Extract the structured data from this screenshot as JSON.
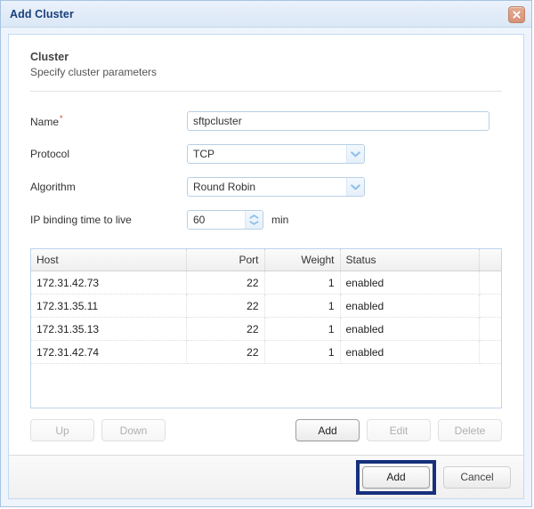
{
  "window": {
    "title": "Add Cluster",
    "close_icon": "close-icon"
  },
  "section": {
    "heading": "Cluster",
    "subtitle": "Specify cluster parameters"
  },
  "form": {
    "name": {
      "label": "Name",
      "required_marker": "*",
      "value": "sftpcluster"
    },
    "protocol": {
      "label": "Protocol",
      "value": "TCP",
      "arrow_icon": "chevron-down-icon"
    },
    "algorithm": {
      "label": "Algorithm",
      "value": "Round Robin",
      "arrow_icon": "chevron-down-icon"
    },
    "ttl": {
      "label": "IP binding time to live",
      "value": "60",
      "unit": "min",
      "up_icon": "chevron-up-icon",
      "down_icon": "chevron-down-icon"
    }
  },
  "grid": {
    "columns": [
      "Host",
      "Port",
      "Weight",
      "Status"
    ],
    "rows": [
      {
        "host": "172.31.42.73",
        "port": "22",
        "weight": "1",
        "status": "enabled"
      },
      {
        "host": "172.31.35.11",
        "port": "22",
        "weight": "1",
        "status": "enabled"
      },
      {
        "host": "172.31.35.13",
        "port": "22",
        "weight": "1",
        "status": "enabled"
      },
      {
        "host": "172.31.42.74",
        "port": "22",
        "weight": "1",
        "status": "enabled"
      }
    ]
  },
  "grid_actions": {
    "up": "Up",
    "down": "Down",
    "add": "Add",
    "edit": "Edit",
    "delete": "Delete"
  },
  "footer": {
    "add": "Add",
    "cancel": "Cancel"
  },
  "colors": {
    "title_text": "#1a3f7a",
    "titlebar_bg": "#e3edf8",
    "close_button": "#d79277",
    "required_asterisk": "#d33b23",
    "field_border": "#b8cfe6",
    "highlight": "#17307e"
  }
}
